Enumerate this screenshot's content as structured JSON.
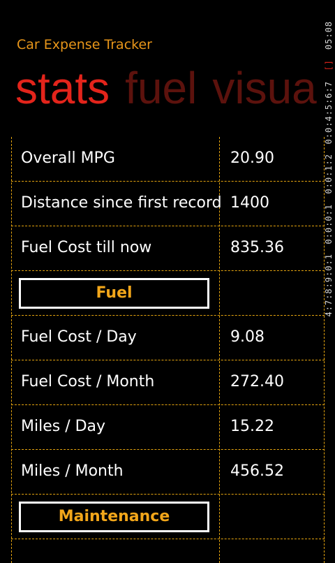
{
  "app": {
    "title": "Car Expense Tracker"
  },
  "pivot": {
    "items": [
      "stats",
      "fuel",
      "visua"
    ]
  },
  "system_tray": {
    "segments": [
      "05:08",
      "[]",
      "0:0:4:5:6:7",
      "0:0:1:2",
      "0:0:0:1",
      "4:7:8:9:0:1"
    ]
  },
  "stats": [
    {
      "label": "Overall MPG",
      "value": "20.90"
    },
    {
      "label": "Distance since first record",
      "value": "1400"
    },
    {
      "label": "Fuel Cost till now",
      "value": "835.36"
    }
  ],
  "sections": {
    "fuel": "Fuel",
    "maintenance": "Maintenance"
  },
  "fuel_stats": [
    {
      "label": "Fuel Cost / Day",
      "value": "9.08"
    },
    {
      "label": "Fuel Cost / Month",
      "value": "272.40"
    },
    {
      "label": "Miles / Day",
      "value": "15.22"
    },
    {
      "label": "Miles / Month",
      "value": "456.52"
    }
  ],
  "colors": {
    "accent": "#e3241b",
    "pivot_inactive": "#5c120d",
    "title": "#e8961a",
    "divider": "#e6a50f"
  }
}
